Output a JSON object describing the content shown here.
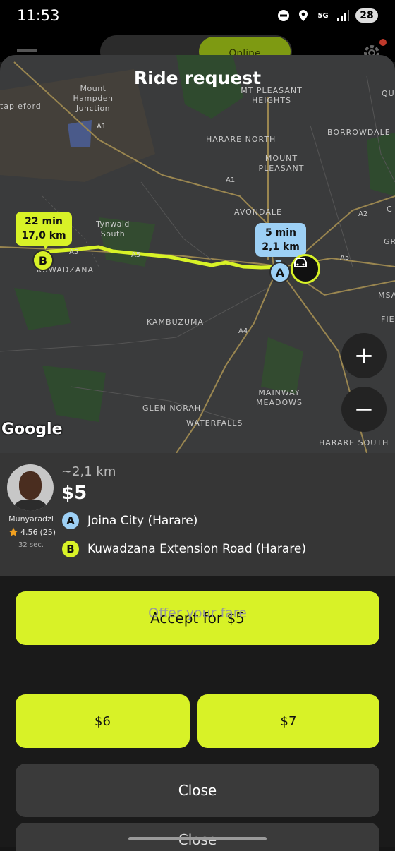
{
  "status_bar": {
    "time": "11:53",
    "network": "5G",
    "battery": "28"
  },
  "header": {
    "online_label": "Online"
  },
  "modal": {
    "title": "Ride request"
  },
  "map": {
    "labels": {
      "tapleford": "tapleford",
      "mount_hampden": "Mount\nHampden\nJunction",
      "mt_pleasant_heights": "MT PLEASANT\nHEIGHTS",
      "qu": "QU",
      "borrowdale": "BORROWDALE",
      "harare_north": "HARARE NORTH",
      "mount_pleasant": "MOUNT\nPLEASANT",
      "avondale": "AVONDALE",
      "tynwald": "Tynwald\nSouth",
      "kuwadzana": "KUWADZANA",
      "kambuzuma": "KAMBUZUMA",
      "mainway": "MAINWAY\nMEADOWS",
      "glen_norah": "GLEN NORAH",
      "waterfalls": "WATERFALLS",
      "harare_south": "HARARE SOUTH",
      "msa": "MSA",
      "c": "C",
      "gr": "GR",
      "fiel": "FIELI"
    },
    "road_tags": {
      "a1_top": "A1",
      "a1_mid": "A1",
      "a5_left": "A5",
      "a5_mid": "A5",
      "a5_right": "A5",
      "a2": "A2",
      "a4": "A4"
    },
    "dest_bubble": {
      "time": "22 min",
      "distance": "17,0 km"
    },
    "pickup_bubble": {
      "time": "5 min",
      "distance": "2,1 km"
    },
    "pin_b": "B",
    "pin_a": "A",
    "zoom_in": "+",
    "zoom_out": "−",
    "attribution": "Google",
    "colors": {
      "route": "#d8f227",
      "pickup": "#9dd0f5",
      "map_bg": "#3a3b3c"
    }
  },
  "ride": {
    "driver_name": "Munyaradzi",
    "rating": "4.56",
    "rating_count": "(25)",
    "elapsed": "32 sec.",
    "distance": "~2,1 km",
    "price": "$5",
    "pickup_marker": "A",
    "pickup_address": "Joina City (Harare)",
    "dropoff_marker": "B",
    "dropoff_address": "Kuwadzana Extension Road (Harare)"
  },
  "actions": {
    "accept_label": "Accept for $5",
    "offer_label": "Offer your fare",
    "fare_option_1": "$6",
    "fare_option_2": "$7",
    "close_label": "Close",
    "peek_label": "Close"
  }
}
